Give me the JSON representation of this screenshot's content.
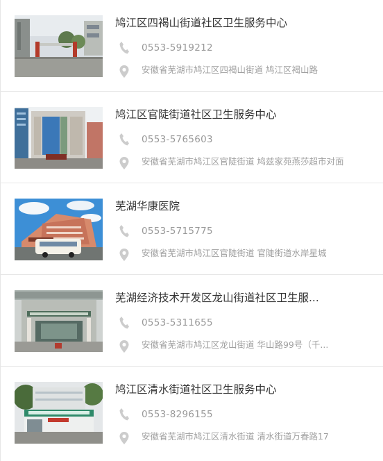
{
  "items": [
    {
      "name": "鸠江区四褐山街道社区卫生服务中心",
      "phone": "0553-5919212",
      "address": "安徽省芜湖市鸠江区四褐山街道 鸠江区褐山路"
    },
    {
      "name": "鸠江区官陡街道社区卫生服务中心",
      "phone": "0553-5765603",
      "address": "安徽省芜湖市鸠江区官陡街道 鸠兹家苑燕莎超市对面"
    },
    {
      "name": "芜湖华康医院",
      "phone": "0553-5715775",
      "address": "安徽省芜湖市鸠江区官陡街道 官陡街道水岸星城"
    },
    {
      "name": "芜湖经济技术开发区龙山街道社区卫生服...",
      "phone": "0553-5311655",
      "address": "安徽省芜湖市鸠江区龙山街道 华山路99号（千..."
    },
    {
      "name": "鸠江区清水街道社区卫生服务中心",
      "phone": "0553-8296155",
      "address": "安徽省芜湖市鸠江区清水街道 清水街道万春路17"
    }
  ],
  "icons": {
    "phone": "phone-icon",
    "location": "location-pin-icon"
  },
  "colors": {
    "text": "#333333",
    "muted": "#999999",
    "icon": "#cccccc",
    "divider": "#e6e6e6"
  }
}
